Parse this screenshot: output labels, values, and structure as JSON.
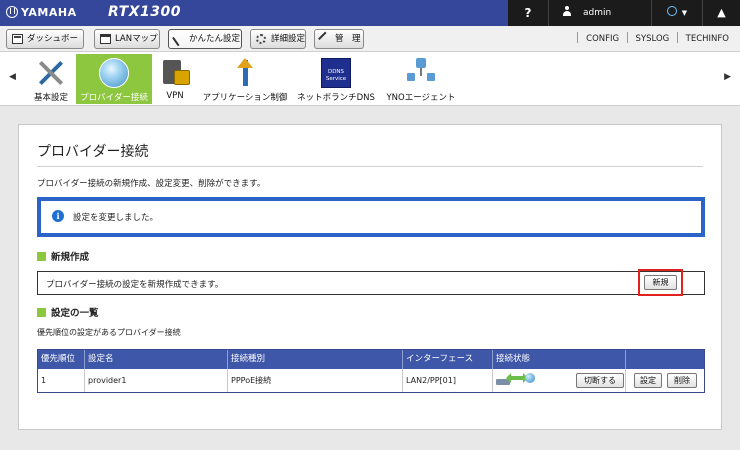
{
  "header": {
    "brand": "YAMAHA",
    "model": "RTX1300",
    "help_label": "?",
    "user_name": "admin",
    "bell_glyph": "▲"
  },
  "tabs": [
    {
      "label": "ダッシュボード",
      "icon": "dashboard-icon"
    },
    {
      "label": "LANマップ",
      "icon": "lan-map-icon"
    },
    {
      "label": "かんたん設定",
      "icon": "easy-setup-icon",
      "active": true
    },
    {
      "label": "詳細設定",
      "icon": "gear-icon"
    },
    {
      "label": "管　理",
      "icon": "wrench-icon"
    }
  ],
  "top_links": [
    "CONFIG",
    "SYSLOG",
    "TECHINFO"
  ],
  "menu": {
    "prev_arrow": "◀",
    "next_arrow": "▶",
    "items": [
      {
        "label": "基本設定",
        "icon": "tools-icon"
      },
      {
        "label": "プロバイダー接続",
        "icon": "globe-icon",
        "active": true
      },
      {
        "label": "VPN",
        "icon": "lock-icon"
      },
      {
        "label": "アプリケーション制御",
        "icon": "app-control-icon"
      },
      {
        "label": "ネットボランチDNS",
        "icon": "ddns-icon"
      },
      {
        "label": "YNOエージェント",
        "icon": "network-icon"
      }
    ],
    "ddns_badge": [
      "DDNS",
      "Service"
    ]
  },
  "page": {
    "title": "プロバイダー接続",
    "description": "プロバイダー接続の新規作成、設定変更、削除ができます。",
    "notice": "設定を変更しました。",
    "new_section_title": "新規作成",
    "new_section_text": "プロバイダー接続の設定を新規作成できます。",
    "new_button": "新規",
    "list_section_title": "設定の一覧",
    "list_description": "優先順位の設定があるプロバイダー接続"
  },
  "table": {
    "headers": [
      "優先順位",
      "設定名",
      "接続種別",
      "インターフェース",
      "接続状態",
      ""
    ],
    "rows": [
      {
        "priority": "1",
        "name": "provider1",
        "type": "PPPoE接続",
        "interface": "LAN2/PP[01]",
        "disconnect_label": "切断する",
        "setting_label": "設定",
        "delete_label": "削除"
      }
    ]
  },
  "colors": {
    "header_blue": "#34479a",
    "accent_green": "#8dc63f",
    "notice_border": "#2c63c9",
    "table_header": "#3e57a8",
    "highlight_red": "#e1231e"
  }
}
